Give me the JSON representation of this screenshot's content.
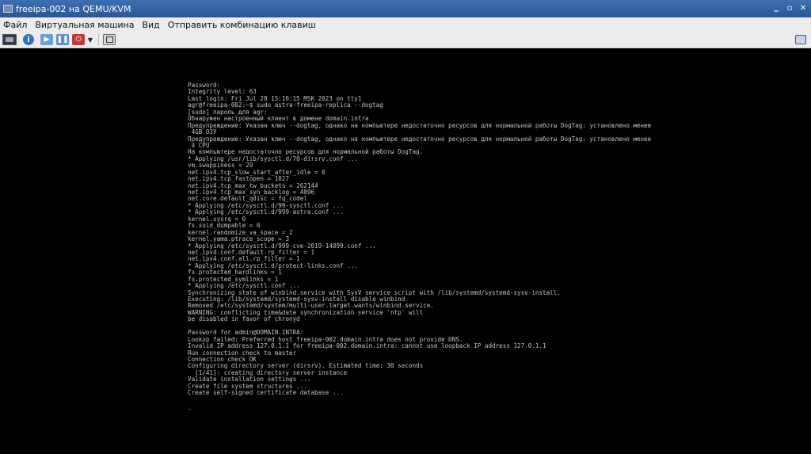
{
  "window": {
    "title": "freeipa-002 на QEMU/KVM",
    "controls": {
      "minimize": "‗",
      "maximize": "▫",
      "close": "✕"
    }
  },
  "menu": {
    "items": [
      "Файл",
      "Виртуальная машина",
      "Вид",
      "Отправить комбинацию клавиш"
    ]
  },
  "toolbar": {
    "buttons": [
      {
        "name": "console",
        "icon": "monitor-icon"
      },
      {
        "name": "details",
        "icon": "info-icon",
        "glyph": "i"
      },
      {
        "name": "run",
        "icon": "play-icon",
        "glyph": "▶"
      },
      {
        "name": "pause",
        "icon": "pause-icon",
        "glyph": "❚❚"
      },
      {
        "name": "shutdown",
        "icon": "power-icon",
        "glyph": "⏻"
      },
      {
        "name": "shutdown-menu",
        "icon": "chevron-down-icon",
        "glyph": "▼"
      },
      {
        "name": "fullscreen",
        "icon": "fullscreen-icon"
      },
      {
        "name": "resize",
        "icon": "screen-resize-icon"
      }
    ]
  },
  "terminal": {
    "lines": [
      "Password:",
      "Integrity level: 63",
      "Last login: Fri Jul 28 15:16:15 MSK 2023 on tty1",
      "agr@freeipa-002:~$ sudo astra-freeipa-replica --dogtag",
      "[sudo] пароль для agr:",
      "Обнаружен настроенный клиент в домене domain.intra",
      "Предупреждение: Указан ключ --dogtag, однако на компьютере недостаточно ресурсов для нормальной работы DogTag: установлено менее",
      " 4GB ОЗУ",
      "Предупреждение: Указан ключ --dogtag, однако на компьютере недостаточно ресурсов для нормальной работы DogTag: установлено менее",
      " 4 CPU",
      "На компьютере недостаточно ресурсов для нормальной работы DogTag.",
      "* Applying /usr/lib/sysctl.d/70-dirsrv.conf ...",
      "vm.swappiness = 20",
      "net.ipv4.tcp_slow_start_after_idle = 0",
      "net.ipv4.tcp_fastopen = 1027",
      "net.ipv4.tcp_max_tw_buckets = 262144",
      "net.ipv4.tcp_max_syn_backlog = 4096",
      "net.core.default_qdisc = fq_codel",
      "* Applying /etc/sysctl.d/99-sysctl.conf ...",
      "* Applying /etc/sysctl.d/999-astra.conf ...",
      "kernel.sysrq = 0",
      "fs.suid_dumpable = 0",
      "kernel.randomize_va_space = 2",
      "kernel.yama.ptrace_scope = 3",
      "* Applying /etc/sysctl.d/999-cve-2019-14899.conf ...",
      "net.ipv4.conf.default.rp_filter = 1",
      "net.ipv4.conf.all.rp_filter = 1",
      "* Applying /etc/sysctl.d/protect-links.conf ...",
      "fs.protected_hardlinks = 1",
      "fs.protected_symlinks = 1",
      "* Applying /etc/sysctl.conf ...",
      "Synchronizing state of winbind.service with SysV service script with /lib/systemd/systemd-sysv-install.",
      "Executing: /lib/systemd/systemd-sysv-install disable winbind",
      "Removed /etc/systemd/system/multi-user.target.wants/winbind.service.",
      "WARNING: conflicting time&date synchronization service 'ntp' will",
      "be disabled in favor of chronyd",
      "",
      "Password for admin@DOMAIN.INTRA:",
      "Lookup failed: Preferred host freeipa-002.domain.intra does not provide DNS.",
      "Invalid IP address 127.0.1.1 for freeipa-002.domain.intra: cannot use loopback IP address 127.0.1.1",
      "Run connection check to master",
      "Connection check OK",
      "Configuring directory server (dirsrv). Estimated time: 30 seconds",
      "  [1/41]: creating directory server instance",
      "Validate installation settings ...",
      "Create file system structures ...",
      "Create self-signed certificate database ...",
      "",
      "_"
    ]
  }
}
